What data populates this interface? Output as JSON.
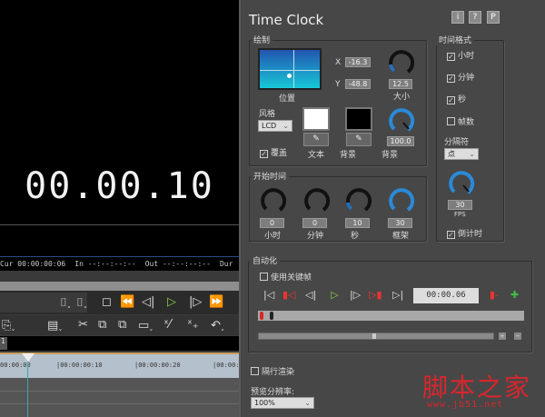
{
  "preview": {
    "timecode": "00.00.10"
  },
  "info": {
    "cur": "Cur 00:00:00:06",
    "in": "In --:--:--:--",
    "out": "Out --:--:--:--",
    "dur": "Dur"
  },
  "timeline": {
    "tab": "1",
    "ruler": [
      "00:00:00",
      "|00:00:00:10",
      "|00:00:00:20",
      "|00:00:"
    ]
  },
  "panel": {
    "title": "Time Clock",
    "header_buttons": [
      "i",
      "?",
      "P"
    ],
    "draw": {
      "label": "绘制",
      "x_label": "X",
      "x": "-16.3",
      "y_label": "Y",
      "y": "-48.8",
      "position_label": "位置",
      "size": "12.5",
      "size_label": "大小",
      "style_label": "风格",
      "style_value": "LCD",
      "overlay_label": "覆盖",
      "overlay_checked": true,
      "text_label": "文本",
      "bg_label": "背景",
      "opacity": "100.0",
      "opacity_label": "背景",
      "text_color": "#ffffff",
      "bg_color": "#000000"
    },
    "start": {
      "label": "开始时间",
      "fields": [
        {
          "value": "0",
          "label": "小时"
        },
        {
          "value": "0",
          "label": "分钟"
        },
        {
          "value": "10",
          "label": "秒"
        },
        {
          "value": "30",
          "label": "框架"
        }
      ]
    },
    "format": {
      "label": "时间格式",
      "hour": "小时",
      "minute": "分钟",
      "second": "秒",
      "frames": "帧数",
      "separator_label": "分隔符",
      "separator": "点",
      "fps": "30",
      "fps_label": "FPS",
      "countdown": "倒计时"
    },
    "auto": {
      "label": "自动化",
      "use_keyframes": "使用关键帧",
      "time": "00:00.06"
    },
    "interlace": "隔行渲染",
    "res_label": "预览分辨率:",
    "res_value": "100%"
  },
  "watermark": {
    "text": "脚本之家",
    "url": "www.jb51.net"
  }
}
